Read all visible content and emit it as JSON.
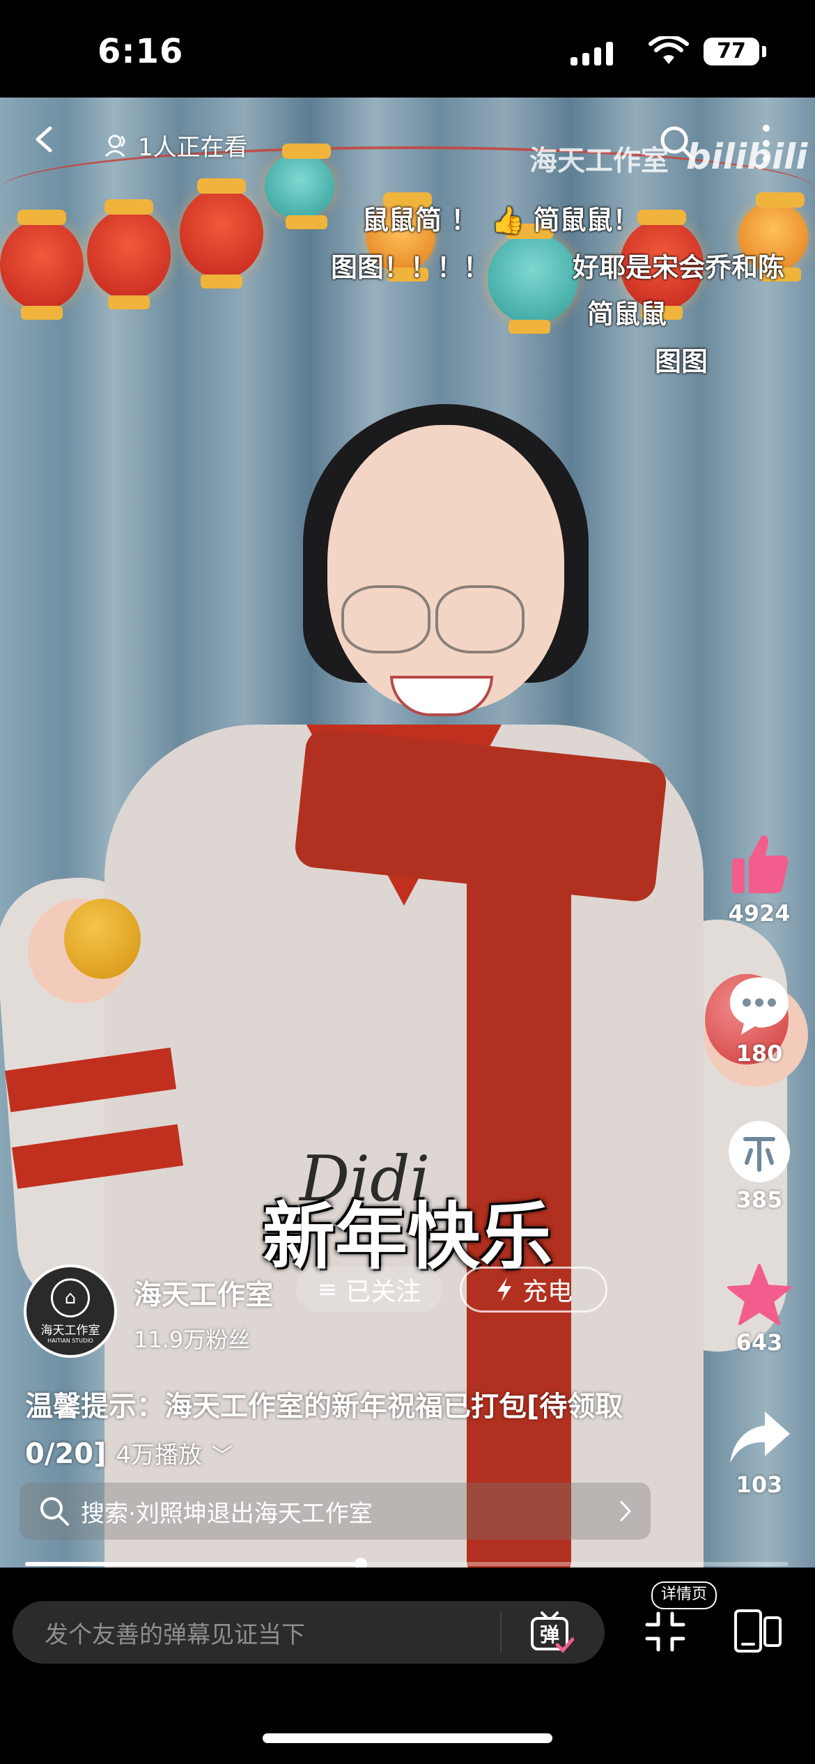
{
  "status_bar": {
    "time": "6:16",
    "battery": "77"
  },
  "top_bar": {
    "watching": "1人正在看",
    "watermark": "海天工作室",
    "watermark_logo": "bilibili"
  },
  "danmaku": [
    "鼠鼠简 ！",
    "简鼠鼠！",
    "图图！！！！",
    "好耶是宋会乔和陈",
    "简鼠鼠",
    "图图"
  ],
  "subtitle": "新年快乐",
  "side_rail": {
    "like_count": "4924",
    "comment_count": "180",
    "coin_count": "385",
    "favorite_count": "643",
    "share_count": "103",
    "accent_color": "#f25d8e"
  },
  "uploader": {
    "name": "海天工作室",
    "fans": "11.9万粉丝",
    "avatar_text": "海天工作室",
    "avatar_subtext": "HAITIAN STUDIO",
    "follow_label": "已关注",
    "charge_label": "充电"
  },
  "video_info": {
    "title": "温馨提示：海天工作室的新年祝福已打包[待领取0/20]",
    "plays": "4万播放"
  },
  "search_suggestion": {
    "text": "搜索·刘照坤退出海天工作室"
  },
  "progress": {
    "fraction": 0.44
  },
  "bottom_bar": {
    "danmaku_placeholder": "发个友善的弹幕见证当下",
    "danmaku_button": "弹",
    "detail_label": "详情页"
  },
  "jersey_text": "Didi"
}
